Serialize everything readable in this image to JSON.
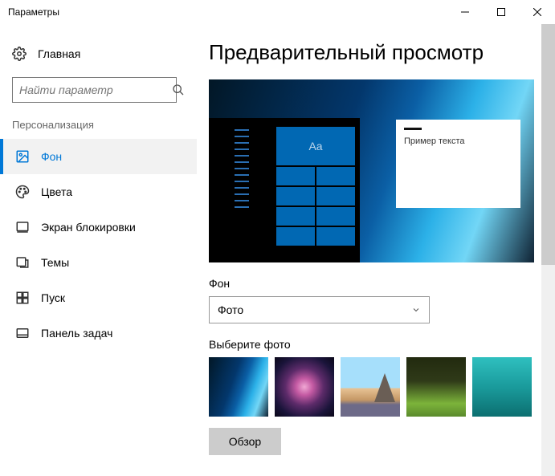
{
  "titlebar": {
    "title": "Параметры"
  },
  "sidebar": {
    "home": "Главная",
    "search_placeholder": "Найти параметр",
    "section": "Персонализация",
    "items": [
      {
        "label": "Фон"
      },
      {
        "label": "Цвета"
      },
      {
        "label": "Экран блокировки"
      },
      {
        "label": "Темы"
      },
      {
        "label": "Пуск"
      },
      {
        "label": "Панель задач"
      }
    ]
  },
  "main": {
    "title": "Предварительный просмотр",
    "preview": {
      "tile_text": "Aa",
      "window_sample": "Пример текста"
    },
    "background_label": "Фон",
    "background_value": "Фото",
    "choose_photo_label": "Выберите фото",
    "browse_label": "Обзор"
  }
}
